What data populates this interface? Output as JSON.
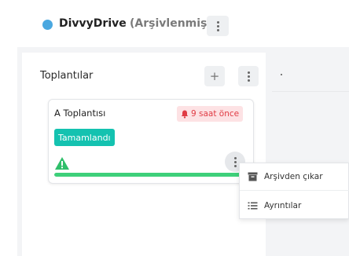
{
  "header": {
    "board_name": "DivvyDrive",
    "board_status": "(Arşivlenmiş)",
    "status_dot_color": "#4aa8e0",
    "menu_icon": "kebab-icon"
  },
  "column": {
    "title": "Toplantılar",
    "add_icon": "+",
    "menu_icon": "kebab-icon",
    "next_column_mark": "."
  },
  "card": {
    "title": "A Toplantısı",
    "due_badge": "9 saat önce",
    "due_icon": "bell-icon",
    "status_badge": "Tamamlandı",
    "warning_icon": "warning-icon",
    "progress_fraction": 1.0,
    "progress_color": "#3ed07a",
    "menu_icon": "kebab-icon"
  },
  "context_menu": {
    "items": [
      {
        "label": "Arşivden çıkar",
        "icon": "archive-icon"
      },
      {
        "label": "Ayrıntılar",
        "icon": "list-icon"
      }
    ]
  },
  "colors": {
    "done_badge": "#14c2b0",
    "due_badge_bg": "#fde2e4",
    "due_badge_text": "#e03b44",
    "warning": "#2fbf6a"
  }
}
